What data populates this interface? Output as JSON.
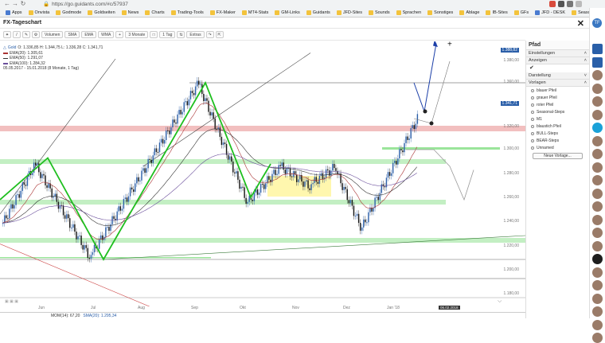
{
  "browser": {
    "url": "https://go.guidants.com/#c/57937",
    "secure_label": "Sicher",
    "bookmarks": [
      "Apps",
      "Onvista",
      "Godmode",
      "Goldseiten",
      "News",
      "Charts",
      "Trading-Tools",
      "FX-Maker",
      "MT4-Stats",
      "GM-Links",
      "Guidants",
      "JFD-Sites",
      "Sounds",
      "Sprachen",
      "Sonstiges",
      "Ablage",
      "IB-Sites",
      "GFs",
      "JFD - DESK",
      "SeasonalBull",
      "JFD - YouTube"
    ]
  },
  "app": {
    "title": "FX-Tageschart",
    "user_initials": "TF"
  },
  "toolbar": {
    "items": [
      "Volumen",
      "SMA",
      "EMA",
      "WMA",
      "3 Monate",
      "1 Tag",
      "Extras"
    ]
  },
  "chart": {
    "legend": {
      "instrument": "Gold",
      "ohlc": "O: 1.336,85  H: 1.344,75  L: 1.336,28  C: 1.341,71",
      "ema20": "EMA(20): 1.305,61",
      "ema50": "EMA(50): 1.291,07",
      "ema100": "EMA(100): 1.284,32",
      "range": "05.05.2017 - 15.01.2018 (8 Monate, 1 Tag)"
    },
    "price_labels": [
      "1.380,00",
      "1.360,00",
      "1.341,71",
      "1.320,00",
      "1.300,00",
      "1.280,00",
      "1.260,00",
      "1.240,00",
      "1.220,00",
      "1.200,00",
      "1.180,00"
    ],
    "highlight_price": "1.388,82",
    "months": [
      "Jun",
      "Jul",
      "Aug",
      "Sep",
      "Okt",
      "Nov",
      "Dez",
      "Jan '18"
    ],
    "date_marker": "06.02.2018",
    "oscillator": {
      "mom": "MOM(14): 67,20",
      "sma": "SMA(20): 1.295,34"
    },
    "colors": {
      "green_zone": "#9be59b",
      "red_zone": "#e88b8b",
      "yellow_zone": "#fff59a",
      "zigzag": "#1fbf1f",
      "projection": "#1c3fa8",
      "candle_up": "#2a5ea8",
      "candle_down": "#111111"
    }
  },
  "panel": {
    "title": "Pfad",
    "sections": {
      "settings": "Einstellungen",
      "display": "Anzeigen",
      "appearance": "Darstellung",
      "templates": "Vorlagen"
    },
    "templates": [
      "blauer Pfeil",
      "grauer Pfeil",
      "roter Pfeil",
      "Seasonal-Steps",
      "M1",
      "blaustich Pfeil",
      "BULL-Steps",
      "BEAR-Steps",
      "Unnamed"
    ],
    "new_template": "Neue Vorlage..."
  }
}
